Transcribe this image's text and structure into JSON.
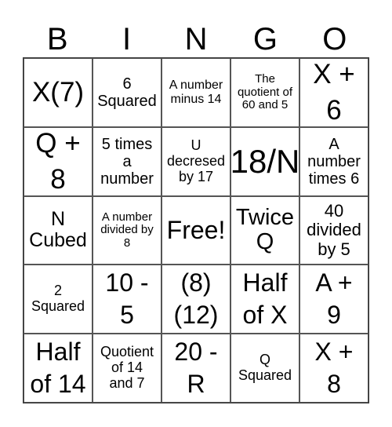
{
  "header": [
    "B",
    "I",
    "N",
    "G",
    "O"
  ],
  "cells": [
    {
      "lines": [
        "X(7)"
      ],
      "size": "s34"
    },
    {
      "lines": [
        "6",
        "Squared"
      ],
      "size": "s20"
    },
    {
      "lines": [
        "A number",
        "minus 14"
      ],
      "size": "s16"
    },
    {
      "lines": [
        "The",
        "quotient of",
        "60 and 5"
      ],
      "size": "s15"
    },
    {
      "lines": [
        "X +",
        "6"
      ],
      "size": "s34"
    },
    {
      "lines": [
        "Q +",
        "8"
      ],
      "size": "s34"
    },
    {
      "lines": [
        "5 times",
        "a",
        "number"
      ],
      "size": "s20"
    },
    {
      "lines": [
        "U",
        "decresed",
        "by 17"
      ],
      "size": "s18"
    },
    {
      "lines": [
        "18/N"
      ],
      "size": "s40"
    },
    {
      "lines": [
        "A",
        "number",
        "times 6"
      ],
      "size": "s20"
    },
    {
      "lines": [
        "N",
        "Cubed"
      ],
      "size": "s24"
    },
    {
      "lines": [
        "A number",
        "divided by",
        "8"
      ],
      "size": "s15"
    },
    {
      "lines": [
        "Free!"
      ],
      "size": "s32"
    },
    {
      "lines": [
        "Twice",
        "Q"
      ],
      "size": "s28"
    },
    {
      "lines": [
        "40",
        "divided",
        "by 5"
      ],
      "size": "s22"
    },
    {
      "lines": [
        "2",
        "Squared"
      ],
      "size": "s18"
    },
    {
      "lines": [
        "10 -",
        "5"
      ],
      "size": "s32"
    },
    {
      "lines": [
        "(8)",
        "(12)"
      ],
      "size": "s32"
    },
    {
      "lines": [
        "Half",
        "of X"
      ],
      "size": "s32"
    },
    {
      "lines": [
        "A +",
        "9"
      ],
      "size": "s32"
    },
    {
      "lines": [
        "Half",
        "of 14"
      ],
      "size": "s32"
    },
    {
      "lines": [
        "Quotient",
        "of 14",
        "and 7"
      ],
      "size": "s18"
    },
    {
      "lines": [
        "20 -",
        "R"
      ],
      "size": "s32"
    },
    {
      "lines": [
        "Q",
        "Squared"
      ],
      "size": "s18"
    },
    {
      "lines": [
        "X +",
        "8"
      ],
      "size": "s32"
    }
  ]
}
